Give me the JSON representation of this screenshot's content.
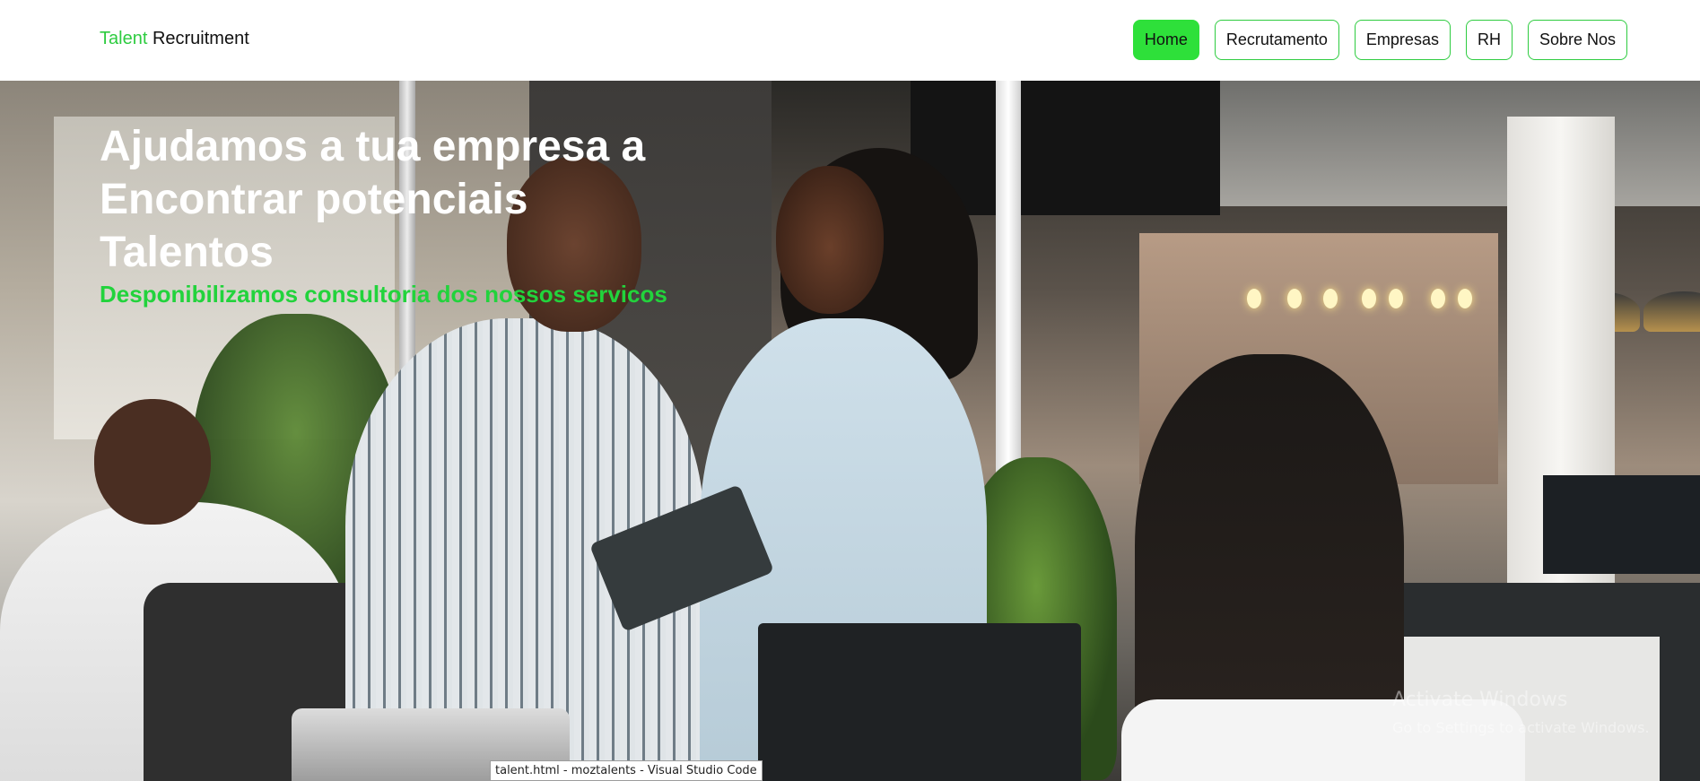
{
  "header": {
    "logo_accent": "Talent",
    "logo_rest": "Recruitment",
    "nav": [
      {
        "label": "Home",
        "active": true
      },
      {
        "label": "Recrutamento",
        "active": false
      },
      {
        "label": "Empresas",
        "active": false
      },
      {
        "label": "RH",
        "active": false
      },
      {
        "label": "Sobre Nos",
        "active": false
      }
    ]
  },
  "hero": {
    "title_line1": "Ajudamos a tua empresa a",
    "title_line2": "Encontrar potenciais",
    "title_line3": "Talentos",
    "subtitle": "Desponibilizamos consultoria dos nossos servicos"
  },
  "overlay": {
    "watermark_title": "Activate Windows",
    "watermark_sub": "Go to Settings to activate Windows.",
    "taskbar_tooltip": "talent.html - moztalents - Visual Studio Code"
  },
  "colors": {
    "accent": "#2ecc40",
    "active_button": "#2ee03a",
    "subtitle": "#22d33c"
  }
}
